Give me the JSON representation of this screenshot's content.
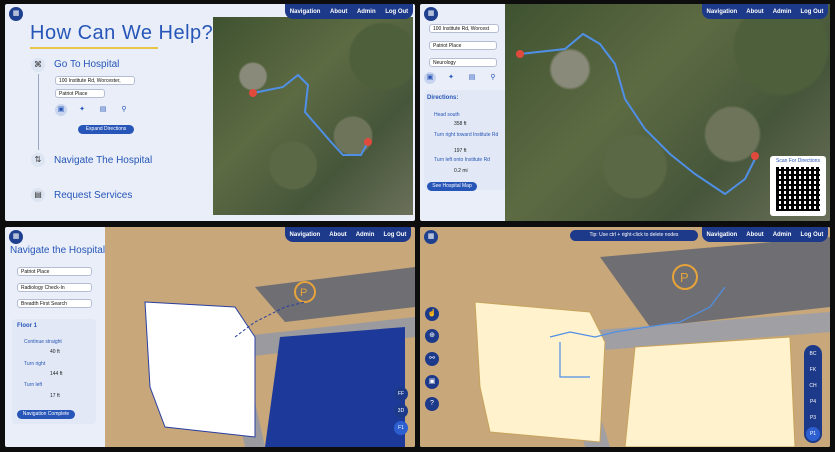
{
  "nav": {
    "items": [
      "Navigation",
      "About",
      "Admin",
      "Log Out"
    ]
  },
  "home": {
    "title": "How Can We Help?",
    "sections": {
      "go": "Go To Hospital",
      "navigate": "Navigate The Hospital",
      "request": "Request Services"
    },
    "address": "100 Institute Rd, Worcester,",
    "destination": "Patriot Place",
    "expand_button": "Expand Directions"
  },
  "directions": {
    "address": "100 Institute Rd, Worcest",
    "destination": "Patriot Place",
    "department": "Neurology",
    "heading": "Directions:",
    "steps": [
      {
        "text": "Head south",
        "dist": "358 ft"
      },
      {
        "text": "Turn right toward Institute Rd",
        "dist": "197 ft"
      },
      {
        "text": "Turn left onto Institute Rd",
        "dist": "0.2 mi"
      }
    ],
    "map_button": "See Hospital Map",
    "qr_title": "Scan For Directions"
  },
  "hospital": {
    "title": "Navigate the Hospital",
    "building": "Patriot Place",
    "destination": "Radiology Check-In",
    "algorithm": "Breadth First Search",
    "floor_label": "Floor 1",
    "steps": [
      {
        "text": "Continue straight",
        "dist": "40 ft"
      },
      {
        "text": "Turn right",
        "dist": "144 ft"
      },
      {
        "text": "Turn left",
        "dist": "17 ft"
      }
    ],
    "complete_button": "Navigation Complete",
    "floors": [
      "FF",
      "3D",
      "F1"
    ]
  },
  "admin": {
    "tip": "Tip: Use ctrl + right-click to delete nodes",
    "floors": [
      "BC",
      "FK",
      "CH",
      "P4",
      "P3",
      "P1"
    ]
  },
  "colors": {
    "primary": "#1d3a8a",
    "accent": "#2756b8",
    "route": "#4f8fe6"
  }
}
